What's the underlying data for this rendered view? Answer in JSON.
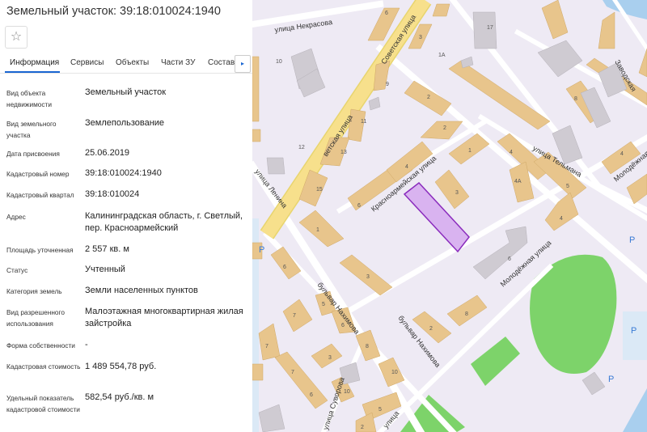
{
  "header": {
    "title": "Земельный участок: 39:18:010024:1940",
    "favorite_icon": "star-icon"
  },
  "tabs": [
    {
      "label": "Информация",
      "active": true
    },
    {
      "label": "Сервисы"
    },
    {
      "label": "Объекты"
    },
    {
      "label": "Части ЗУ"
    },
    {
      "label": "Состав"
    }
  ],
  "tabs_scroll_icon": "▸",
  "fields": [
    {
      "label": "Вид объекта недвижимости",
      "value": "Земельный участок"
    },
    {
      "label": "Вид земельного участка",
      "value": "Землепользование"
    },
    {
      "label": "Дата присвоения",
      "value": "25.06.2019"
    },
    {
      "label": "Кадастровый номер",
      "value": "39:18:010024:1940"
    },
    {
      "label": "Кадастровый квартал",
      "value": "39:18:010024"
    },
    {
      "label": "Адрес",
      "value": "Калининградская область, г. Светлый, пер. Красноармейский"
    },
    {
      "label": "Площадь уточненная",
      "value": "2 557 кв. м"
    },
    {
      "label": "Статус",
      "value": "Учтенный"
    },
    {
      "label": "Категория земель",
      "value": "Земли населенных пунктов"
    },
    {
      "label": "Вид разрешенного использования",
      "value": "Малоэтажная многоквартирная жилая зайстройка"
    },
    {
      "label": "Форма собственности",
      "value": "-"
    },
    {
      "label": "Кадастровая стоимость",
      "value": "1 489 554,78 руб."
    },
    {
      "label": "Удельный показатель кадастровой стоимости",
      "value": "582,54 руб./кв. м"
    }
  ],
  "map": {
    "streets": {
      "nekrasova": "улица Некрасова",
      "sovetskaya": "Советская улица",
      "sovetskaya_lower": "ветская улица",
      "krasnoarmeyskaya": "Красноармейская улица",
      "telmana": "улица Тельмана",
      "molodezhnaya": "Молодёжная улица",
      "molodezhnaya_right": "Молодёжная",
      "zavodskaya": "Заводская",
      "lenina": "улица Ленина",
      "nakhimova_left": "бульвар Нахимова",
      "nakhimova_right": "бульвар Нахимова",
      "suvorova": "улица Суворова",
      "bottom_street": "улица"
    },
    "house_numbers": [
      "6",
      "17",
      "3",
      "1А",
      "10",
      "9",
      "2",
      "11",
      "12",
      "13",
      "15",
      "4",
      "1",
      "4",
      "3",
      "6",
      "1",
      "5",
      "4А",
      "6",
      "4",
      "4",
      "2",
      "7",
      "6",
      "3",
      "8",
      "6",
      "5",
      "2",
      "7",
      "7",
      "3",
      "8",
      "10",
      "6",
      "10",
      "5",
      "2",
      "8"
    ],
    "parking_label": "P",
    "colors": {
      "parcel_fill": "#d9b3f0",
      "parcel_stroke": "#8a2bbd",
      "building": "#e8c58c",
      "park": "#7dd36a",
      "road_main": "#f7e08c"
    }
  }
}
